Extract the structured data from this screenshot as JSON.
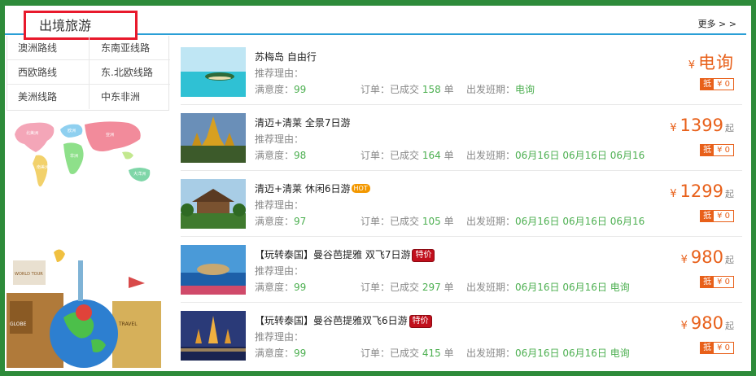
{
  "header": {
    "title": "出境旅游",
    "more": "更多 > >"
  },
  "menu": [
    [
      "澳洲路线",
      "东南亚线路"
    ],
    [
      "西欧路线",
      "东.北欧线路"
    ],
    [
      "美洲线路",
      "中东非洲"
    ]
  ],
  "colors": {
    "accent": "#2a9fd6",
    "price": "#e8601a",
    "frame": "#2e8b3a",
    "highlight_box": "#e8192c",
    "value_green": "#4caf50"
  },
  "labels": {
    "reason": "推荐理由：",
    "satisfaction": "满意度：",
    "order_prefix": "订单：已成交",
    "order_unit": "单",
    "departure": "出发班期：",
    "yen": "¥",
    "qi": "起",
    "di": "抵",
    "coupon_amount": "¥ 0"
  },
  "products": [
    {
      "name": "苏梅岛 自由行",
      "badge": "",
      "satisfaction": "99",
      "orders": "158",
      "departure": "电询",
      "price": "电询",
      "from": false,
      "thumb": "island"
    },
    {
      "name": "清迈+清莱 全景7日游",
      "badge": "",
      "satisfaction": "98",
      "orders": "164",
      "departure": "06月16日 06月16日 06月16日",
      "price": "1399",
      "from": true,
      "thumb": "temple"
    },
    {
      "name": "清迈+清莱 休闲6日游",
      "badge": "HOT",
      "satisfaction": "97",
      "orders": "105",
      "departure": "06月16日 06月16日 06月16日",
      "price": "1299",
      "from": true,
      "thumb": "pavilion"
    },
    {
      "name": "【玩转泰国】曼谷芭提雅 双飞7日游",
      "badge": "特价",
      "satisfaction": "99",
      "orders": "297",
      "departure": "06月16日 06月16日 电询",
      "price": "980",
      "from": true,
      "thumb": "coast"
    },
    {
      "name": "【玩转泰国】曼谷芭提雅双飞6日游",
      "badge": "特价",
      "satisfaction": "99",
      "orders": "415",
      "departure": "06月16日 06月16日 电询",
      "price": "980",
      "from": true,
      "thumb": "night"
    }
  ],
  "map_labels": [
    "北美洲",
    "欧洲",
    "亚洲",
    "非洲",
    "南美洲",
    "大洋洲"
  ],
  "travel_labels": [
    "GLOBE",
    "TRAVEL",
    "WORLD TOUR"
  ]
}
